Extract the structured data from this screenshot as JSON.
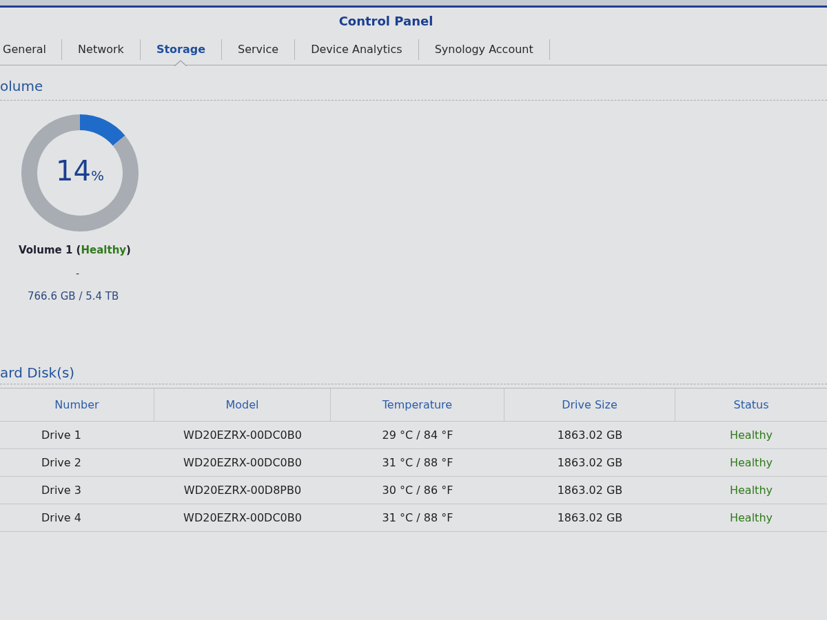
{
  "window": {
    "title": "Control Panel"
  },
  "tabs": [
    {
      "label": "General",
      "selected": false
    },
    {
      "label": "Network",
      "selected": false
    },
    {
      "label": "Storage",
      "selected": true
    },
    {
      "label": "Service",
      "selected": false
    },
    {
      "label": "Device Analytics",
      "selected": false
    },
    {
      "label": "Synology Account",
      "selected": false
    }
  ],
  "volume_section": {
    "heading": "olume"
  },
  "volume": {
    "chart_data": {
      "type": "donut",
      "values": [
        14,
        86
      ]
    },
    "percent": "14",
    "percent_unit": "%",
    "name": "Volume 1 (",
    "status": "Healthy",
    "name_close": ")",
    "detail": "-",
    "usage": "766.6 GB / 5.4 TB"
  },
  "disks_section": {
    "heading": "ard Disk(s)"
  },
  "disk_table": {
    "columns": [
      "Number",
      "Model",
      "Temperature",
      "Drive Size",
      "Status"
    ],
    "rows": [
      {
        "number": "Drive 1",
        "model": "WD20EZRX-00DC0B0",
        "temperature": "29 °C / 84 °F",
        "drive_size": "1863.02 GB",
        "status": "Healthy"
      },
      {
        "number": "Drive 2",
        "model": "WD20EZRX-00DC0B0",
        "temperature": "31 °C / 88 °F",
        "drive_size": "1863.02 GB",
        "status": "Healthy"
      },
      {
        "number": "Drive 3",
        "model": "WD20EZRX-00D8PB0",
        "temperature": "30 °C / 86 °F",
        "drive_size": "1863.02 GB",
        "status": "Healthy"
      },
      {
        "number": "Drive 4",
        "model": "WD20EZRX-00DC0B0",
        "temperature": "31 °C / 88 °F",
        "drive_size": "1863.02 GB",
        "status": "Healthy"
      }
    ]
  }
}
